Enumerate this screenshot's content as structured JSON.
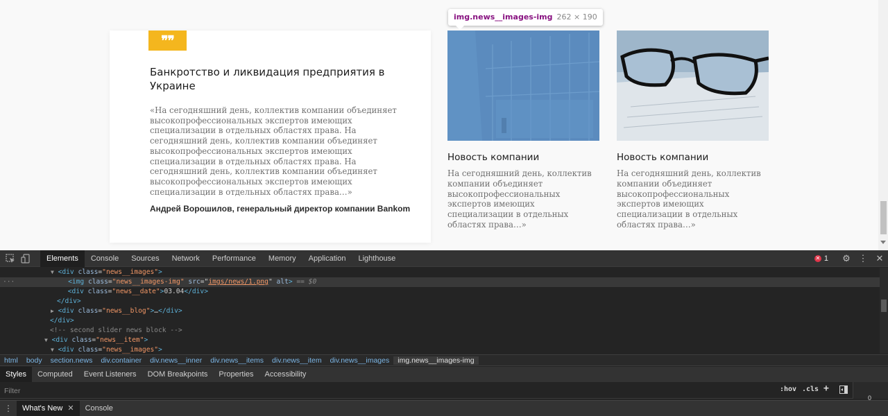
{
  "quote_card": {
    "badge": "❞❞",
    "title": "Банкротство и ликвидация предприятия в Украине",
    "text": "«На сегодняшний день, коллектив компании объединяет высокопрофессиональных экспертов имеющих специализации в отдельных областях права. На сегодняшний день, коллектив компании объединяет высокопрофессиональных экспертов имеющих специализации в отдельных областях права. На сегодняшний день, коллектив компании объединяет высокопрофессиональных экспертов имеющих специализации в отдельных областях права…»",
    "author": "Андрей Ворошилов, генеральный директор компании Bankom"
  },
  "news": [
    {
      "title": "Новость компании",
      "text": "На сегодняшний день, коллектив компании объединяет высокопрофессиональных экспертов имеющих специализации в отдельных областях права…»"
    },
    {
      "title": "Новость компании",
      "text": "На сегодняшний день, коллектив компании объединяет высокопрофессиональных экспертов имеющих специализации в отдельных областях права…»"
    }
  ],
  "inspect_tooltip": {
    "selector": "img.news__images-img",
    "size": "262 × 190"
  },
  "devtools": {
    "tabs": [
      "Elements",
      "Console",
      "Sources",
      "Network",
      "Performance",
      "Memory",
      "Application",
      "Lighthouse"
    ],
    "active_tab": "Elements",
    "error_count": "1",
    "dom": {
      "l1_tag_open": "<div",
      "l1_attr": "class",
      "l1_val": "\"news__images\"",
      "l1_tag_close": ">",
      "l2_tag_open": "<img",
      "l2_attr_class": "class",
      "l2_val_class": "\"news__images-img\"",
      "l2_attr_src": "src",
      "l2_val_src": "imgs/news/1.png",
      "l2_attr_alt": "alt",
      "l2_tail": ">",
      "l2_marker": "== $0",
      "l3_tag_open": "<div",
      "l3_attr": "class",
      "l3_val": "\"news__date\"",
      "l3_text": "03.04",
      "l3_tag_end": "</div>",
      "l4_tag": "</div>",
      "l5_tag_open": "<div",
      "l5_attr": "class",
      "l5_val": "\"news__blog\"",
      "l5_ellipsis": "…",
      "l5_tag_end": "</div>",
      "l6_tag": "</div>",
      "l7_comment": "<!-- second slider news block -->",
      "l8_tag_open": "<div",
      "l8_attr": "class",
      "l8_val": "\"news__item\"",
      "l9_tag_open": "<div",
      "l9_attr": "class",
      "l9_val": "\"news__images\""
    },
    "breadcrumbs": [
      "html",
      "body",
      "section.news",
      "div.container",
      "div.news__inner",
      "div.news__items",
      "div.news__item",
      "div.news__images",
      "img.news__images-img"
    ],
    "sub_tabs": [
      "Styles",
      "Computed",
      "Event Listeners",
      "DOM Breakpoints",
      "Properties",
      "Accessibility"
    ],
    "filter_placeholder": "Filter",
    "hov_label": ":hov",
    "cls_label": ".cls",
    "side_value": "0",
    "drawer_tabs": [
      "What's New",
      "Console"
    ]
  }
}
